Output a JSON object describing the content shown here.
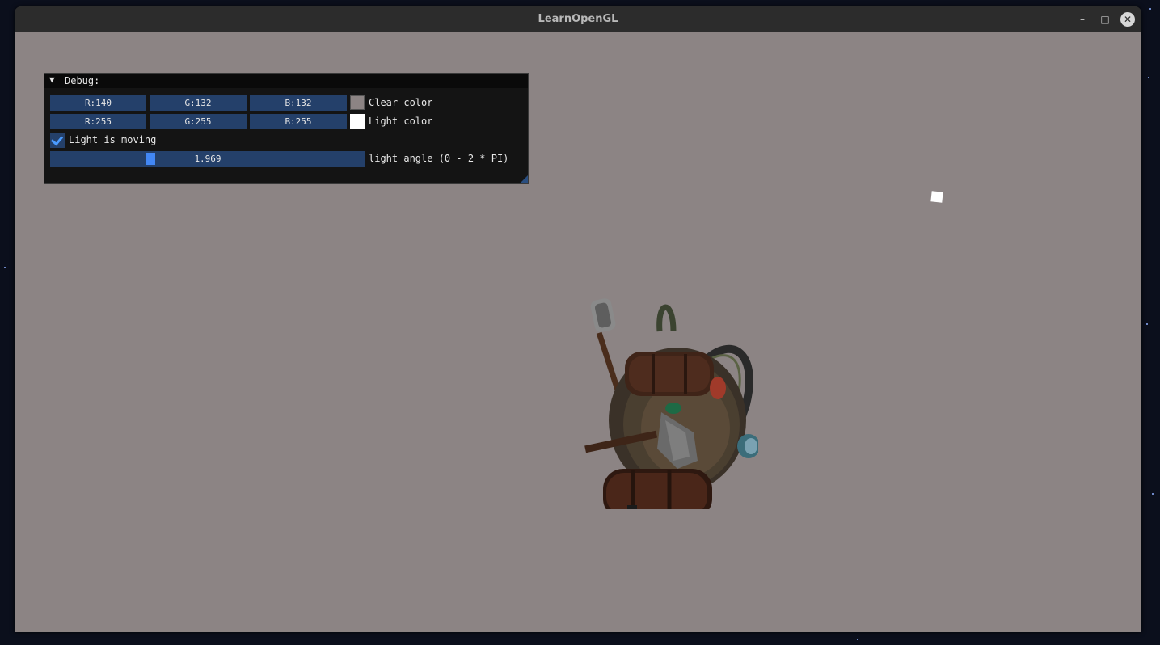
{
  "window": {
    "title": "LearnOpenGL",
    "minimize_glyph": "–",
    "maximize_glyph": "□",
    "close_glyph": "✕",
    "viewport_clear_color": "#8c8484"
  },
  "debug_panel": {
    "title": "Debug:",
    "collapse_icon": "▼",
    "clear_color": {
      "r": "R:140",
      "g": "G:132",
      "b": "B:132",
      "label": "Clear color",
      "swatch": "#8c8484"
    },
    "light_color": {
      "r": "R:255",
      "g": "G:255",
      "b": "B:255",
      "label": "Light color",
      "swatch": "#ffffff"
    },
    "light_moving": {
      "checked": true,
      "label": "Light is moving"
    },
    "light_angle": {
      "value": "1.969",
      "fraction": 0.3134,
      "label": "light angle (0 - 2 * PI)"
    }
  },
  "scene": {
    "light_color": "#ffffff",
    "model_icon": "backpack-model-icon"
  }
}
